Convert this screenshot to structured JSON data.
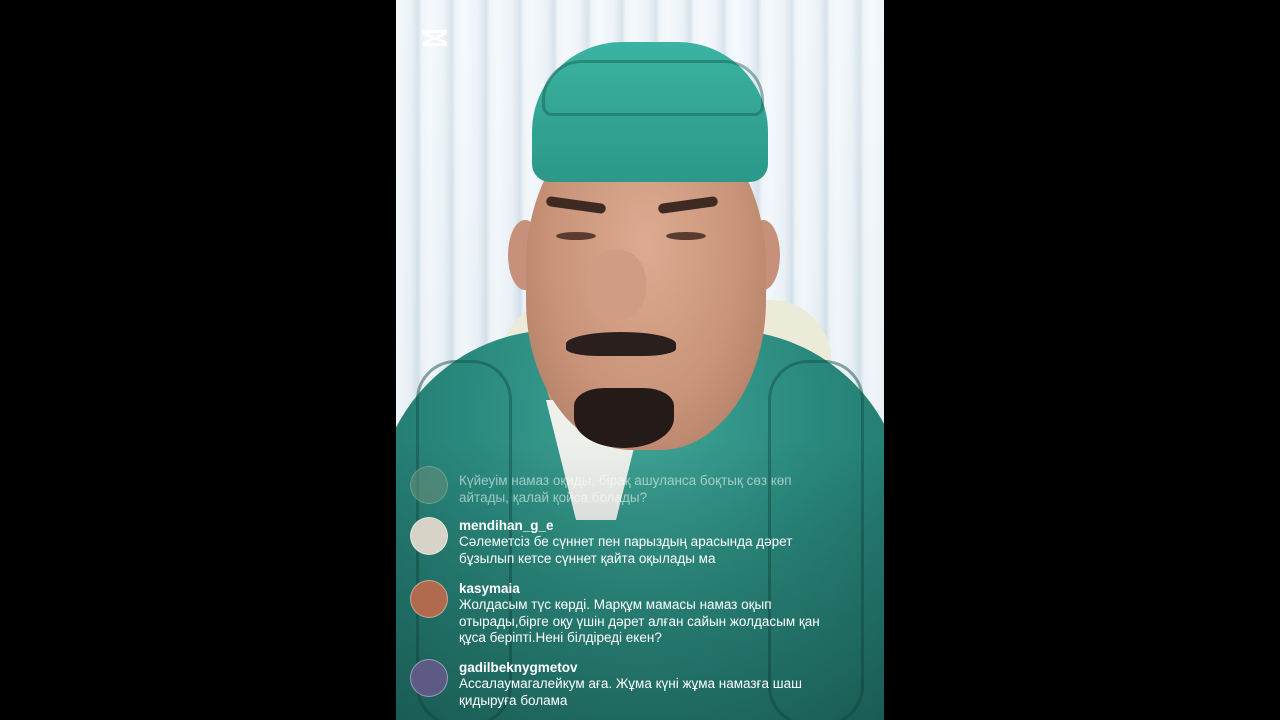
{
  "app": {
    "logo_icon": "capcut-logo-icon"
  },
  "comments": [
    {
      "username": "",
      "text": "Күйеуім намаз оқиды, бірақ ашуланса боқтық сөз көп айтады, қалай қойса болады?",
      "avatar_color": "#6b8f7a",
      "faded": true
    },
    {
      "username": "mendihan_g_e",
      "text": "Сәлеметсіз бе сүннет пен парыздың арасында дәрет бұзылып кетсе сүннет қайта оқылады ма",
      "avatar_color": "#d7d3c6"
    },
    {
      "username": "kasymaia",
      "text": "Жолдасым түс көрді. Марқұм мамасы намаз оқып отырады,бірге оқу үшін дәрет алған сайын жолдасым қан құса беріпті.Нені білдіреді екен?",
      "avatar_color": "#b06a4d"
    },
    {
      "username": "gadilbeknygmetov",
      "text": "Ассалаумагалейкум аға. Жұма күні жұма намазға шаш қидыруға болама",
      "avatar_color": "#5d5a86"
    }
  ]
}
